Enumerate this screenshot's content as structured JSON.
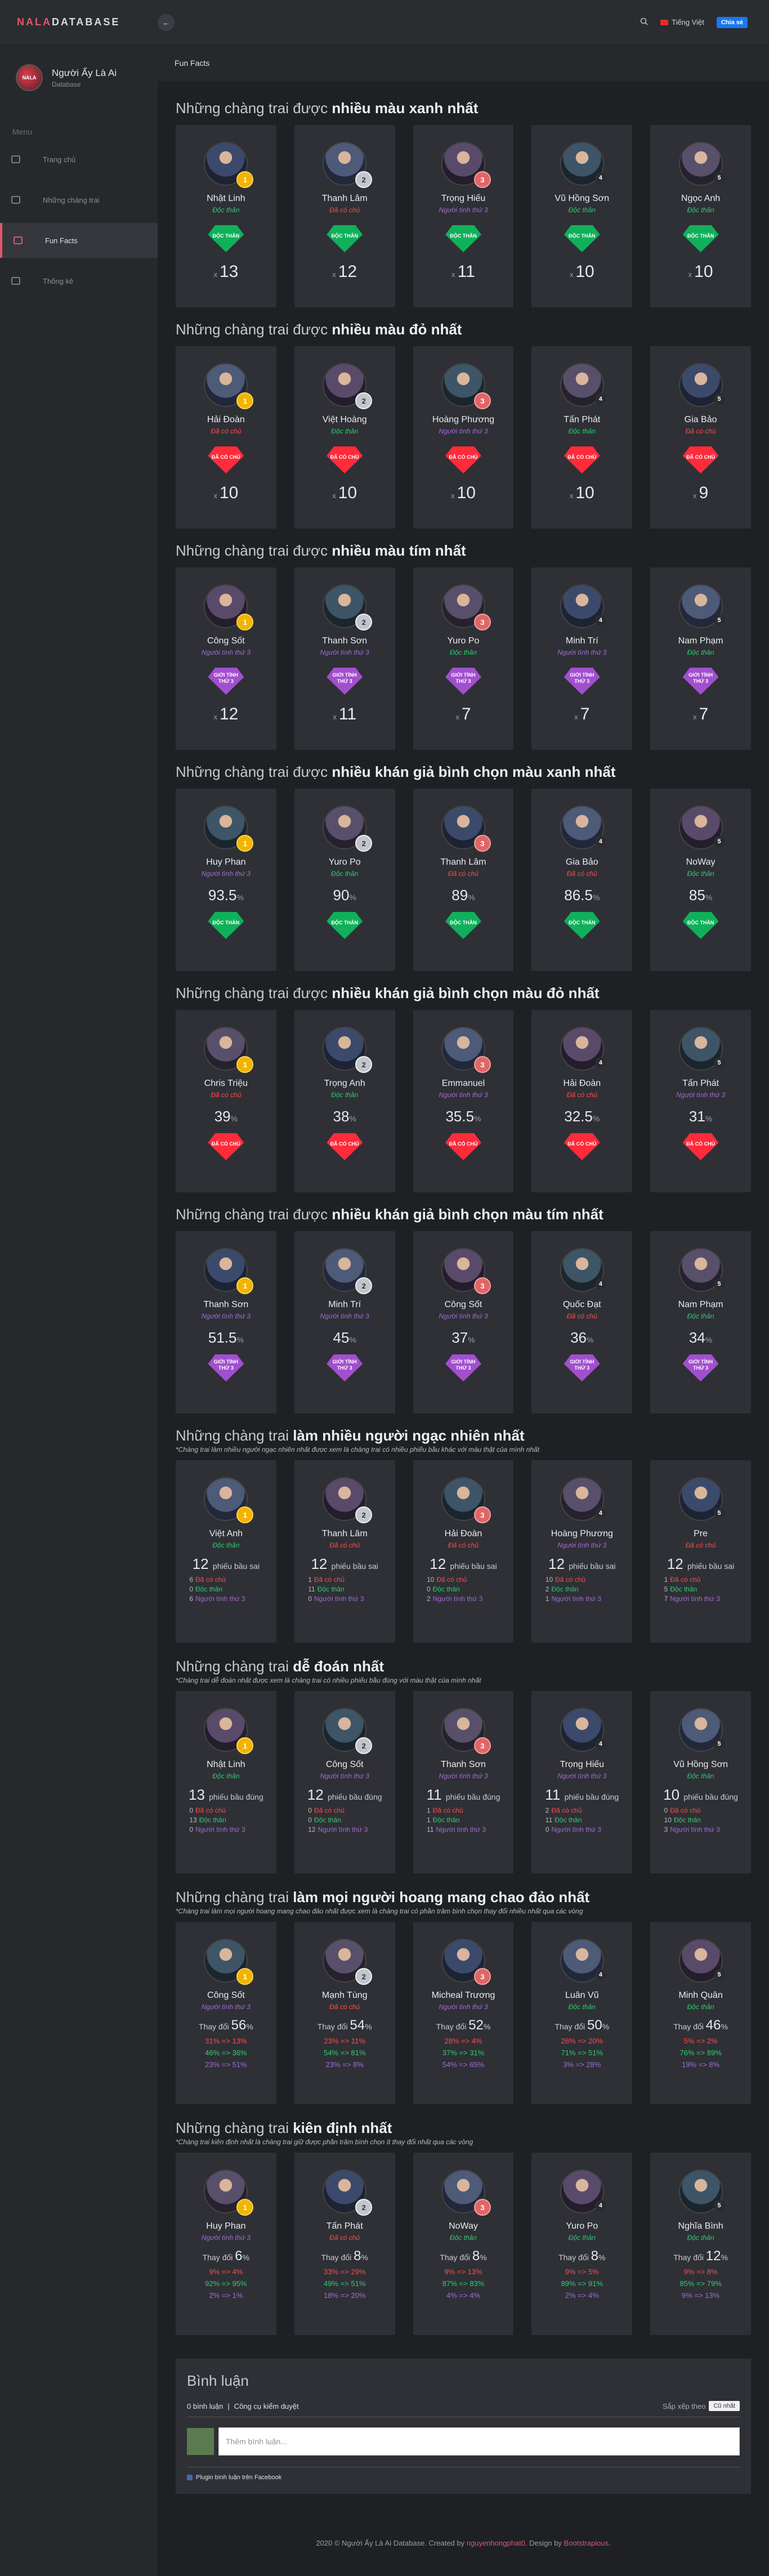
{
  "logo": {
    "part1": "NALA",
    "part2": "DATABASE"
  },
  "topbar": {
    "language": "Tiếng Việt",
    "chat": "Chia sẻ"
  },
  "user": {
    "name": "Người Ấy Là Ai",
    "sub": "Database",
    "avatar_text": "NALA"
  },
  "menu": {
    "label": "Menu",
    "items": [
      {
        "label": "Trang chủ"
      },
      {
        "label": "Những chàng trai"
      },
      {
        "label": "Fun Facts"
      },
      {
        "label": "Thống kê"
      }
    ]
  },
  "breadcrumb": "Fun Facts",
  "sections": [
    {
      "prefix": "Những chàng trai được ",
      "bold": "nhiều màu xanh nhất",
      "kind": "count",
      "note": "",
      "cards": [
        {
          "name": "Nhật Linh",
          "status": "Độc thân",
          "color": "green",
          "gem": "ĐỘC THÂN",
          "value": "13"
        },
        {
          "name": "Thanh Lâm",
          "status": "Đã có chủ",
          "color": "red",
          "gem": "ĐỘC THÂN",
          "value": "12"
        },
        {
          "name": "Trọng Hiếu",
          "status": "Người tình thứ 3",
          "color": "purple",
          "gem": "ĐỘC THÂN",
          "value": "11"
        },
        {
          "name": "Vũ Hồng Sơn",
          "status": "Độc thân",
          "color": "green",
          "gem": "ĐỘC THÂN",
          "value": "10"
        },
        {
          "name": "Ngọc Anh",
          "status": "Độc thân",
          "color": "green",
          "gem": "ĐỘC THÂN",
          "value": "10"
        }
      ]
    },
    {
      "prefix": "Những chàng trai được ",
      "bold": "nhiều màu đỏ nhất",
      "kind": "count",
      "note": "",
      "cards": [
        {
          "name": "Hải Đoàn",
          "status": "Đã có chủ",
          "color": "red",
          "gem": "ĐÃ CÓ CHỦ",
          "value": "10"
        },
        {
          "name": "Việt Hoàng",
          "status": "Độc thân",
          "color": "green",
          "gem": "ĐÃ CÓ CHỦ",
          "value": "10"
        },
        {
          "name": "Hoàng Phương",
          "status": "Người tình thứ 3",
          "color": "purple",
          "gem": "ĐÃ CÓ CHỦ",
          "value": "10"
        },
        {
          "name": "Tấn Phát",
          "status": "Độc thân",
          "color": "green",
          "gem": "ĐÃ CÓ CHỦ",
          "value": "10"
        },
        {
          "name": "Gia Bảo",
          "status": "Đã có chủ",
          "color": "red",
          "gem": "ĐÃ CÓ CHỦ",
          "value": "9"
        }
      ]
    },
    {
      "prefix": "Những chàng trai được ",
      "bold": "nhiều màu tím nhất",
      "kind": "count",
      "note": "",
      "cards": [
        {
          "name": "Công Sốt",
          "status": "Người tình thứ 3",
          "color": "purple",
          "gem": "GIỚI TÍNH THỨ 3",
          "value": "12"
        },
        {
          "name": "Thanh Sơn",
          "status": "Người tình thứ 3",
          "color": "purple",
          "gem": "GIỚI TÍNH THỨ 3",
          "value": "11"
        },
        {
          "name": "Yuro Po",
          "status": "Độc thân",
          "color": "green",
          "gem": "GIỚI TÍNH THỨ 3",
          "value": "7"
        },
        {
          "name": "Minh Trí",
          "status": "Người tình thứ 3",
          "color": "purple",
          "gem": "GIỚI TÍNH THỨ 3",
          "value": "7"
        },
        {
          "name": "Nam Phạm",
          "status": "Độc thân",
          "color": "green",
          "gem": "GIỚI TÍNH THỨ 3",
          "value": "7"
        }
      ]
    },
    {
      "prefix": "Những chàng trai được ",
      "bold": "nhiều khán giả bình chọn màu xanh nhất",
      "kind": "pct",
      "note": "",
      "cards": [
        {
          "name": "Huy Phan",
          "status": "Người tình thứ 3",
          "color": "purple",
          "gem": "ĐỘC THÂN",
          "value": "93.5"
        },
        {
          "name": "Yuro Po",
          "status": "Độc thân",
          "color": "green",
          "gem": "ĐỘC THÂN",
          "value": "90"
        },
        {
          "name": "Thanh Lâm",
          "status": "Đã có chủ",
          "color": "red",
          "gem": "ĐỘC THÂN",
          "value": "89"
        },
        {
          "name": "Gia Bảo",
          "status": "Đã có chủ",
          "color": "red",
          "gem": "ĐỘC THÂN",
          "value": "86.5"
        },
        {
          "name": "NoWay",
          "status": "Độc thân",
          "color": "green",
          "gem": "ĐỘC THÂN",
          "value": "85"
        }
      ]
    },
    {
      "prefix": "Những chàng trai được ",
      "bold": "nhiều khán giả bình chọn màu đỏ nhất",
      "kind": "pct",
      "note": "",
      "cards": [
        {
          "name": "Chris Triệu",
          "status": "Đã có chủ",
          "color": "red",
          "gem": "ĐÃ CÓ CHỦ",
          "value": "39"
        },
        {
          "name": "Trọng Anh",
          "status": "Độc thân",
          "color": "green",
          "gem": "ĐÃ CÓ CHỦ",
          "value": "38"
        },
        {
          "name": "Emmanuel",
          "status": "Người tình thứ 3",
          "color": "purple",
          "gem": "ĐÃ CÓ CHỦ",
          "value": "35.5"
        },
        {
          "name": "Hải Đoàn",
          "status": "Đã có chủ",
          "color": "red",
          "gem": "ĐÃ CÓ CHỦ",
          "value": "32.5"
        },
        {
          "name": "Tấn Phát",
          "status": "Người tình thứ 3",
          "color": "purple",
          "gem": "ĐÃ CÓ CHỦ",
          "value": "31"
        }
      ]
    },
    {
      "prefix": "Những chàng trai được ",
      "bold": "nhiều khán giả bình chọn màu tím nhất",
      "kind": "pct",
      "note": "",
      "cards": [
        {
          "name": "Thanh Sơn",
          "status": "Người tình thứ 3",
          "color": "purple",
          "gem": "GIỚI TÍNH THỨ 3",
          "value": "51.5"
        },
        {
          "name": "Minh Trí",
          "status": "Người tình thứ 3",
          "color": "purple",
          "gem": "GIỚI TÍNH THỨ 3",
          "value": "45"
        },
        {
          "name": "Công Sốt",
          "status": "Người tình thứ 3",
          "color": "purple",
          "gem": "GIỚI TÍNH THỨ 3",
          "value": "37"
        },
        {
          "name": "Quốc Đạt",
          "status": "Đã có chủ",
          "color": "red",
          "gem": "GIỚI TÍNH THỨ 3",
          "value": "36"
        },
        {
          "name": "Nam Phạm",
          "status": "Độc thân",
          "color": "green",
          "gem": "GIỚI TÍNH THỨ 3",
          "value": "34"
        }
      ]
    },
    {
      "prefix": "Những chàng trai ",
      "bold": "làm nhiều người ngạc nhiên nhất",
      "kind": "votes",
      "note": "*Chàng trai làm nhiều người ngạc nhiên nhất được xem là chàng trai có nhiều phiếu bầu khác với màu thật của mình nhất",
      "unit": "phiếu bầu sai",
      "cards": [
        {
          "name": "Việt Anh",
          "status": "Độc thân",
          "color": "green",
          "value": "12",
          "rows": [
            {
              "n": "6",
              "t": "Đã có chủ",
              "c": "red"
            },
            {
              "n": "0",
              "t": "Độc thân",
              "c": "green"
            },
            {
              "n": "6",
              "t": "Người tình thứ 3",
              "c": "purple"
            }
          ]
        },
        {
          "name": "Thanh Lâm",
          "status": "Đã có chủ",
          "color": "red",
          "value": "12",
          "rows": [
            {
              "n": "1",
              "t": "Đã có chủ",
              "c": "red"
            },
            {
              "n": "11",
              "t": "Độc thân",
              "c": "green"
            },
            {
              "n": "0",
              "t": "Người tình thứ 3",
              "c": "purple"
            }
          ]
        },
        {
          "name": "Hải Đoàn",
          "status": "Đã có chủ",
          "color": "red",
          "value": "12",
          "rows": [
            {
              "n": "10",
              "t": "Đã có chủ",
              "c": "red"
            },
            {
              "n": "0",
              "t": "Độc thân",
              "c": "green"
            },
            {
              "n": "2",
              "t": "Người tình thứ 3",
              "c": "purple"
            }
          ]
        },
        {
          "name": "Hoàng Phương",
          "status": "Người tình thứ 3",
          "color": "purple",
          "value": "12",
          "rows": [
            {
              "n": "10",
              "t": "Đã có chủ",
              "c": "red"
            },
            {
              "n": "2",
              "t": "Độc thân",
              "c": "green"
            },
            {
              "n": "1",
              "t": "Người tình thứ 3",
              "c": "purple"
            }
          ]
        },
        {
          "name": "Pre",
          "status": "Đã có chủ",
          "color": "red",
          "value": "12",
          "rows": [
            {
              "n": "1",
              "t": "Đã có chủ",
              "c": "red"
            },
            {
              "n": "5",
              "t": "Độc thân",
              "c": "green"
            },
            {
              "n": "7",
              "t": "Người tình thứ 3",
              "c": "purple"
            }
          ]
        }
      ]
    },
    {
      "prefix": "Những chàng trai ",
      "bold": "dễ đoán nhất",
      "kind": "votes",
      "note": "*Chàng trai dễ đoán nhất được xem là chàng trai có nhiều phiếu bầu đúng với màu thật của mình nhất",
      "unit": "phiếu bầu đúng",
      "cards": [
        {
          "name": "Nhật Linh",
          "status": "Độc thân",
          "color": "green",
          "value": "13",
          "rows": [
            {
              "n": "0",
              "t": "Đã có chủ",
              "c": "red"
            },
            {
              "n": "13",
              "t": "Độc thân",
              "c": "green"
            },
            {
              "n": "0",
              "t": "Người tình thứ 3",
              "c": "purple"
            }
          ]
        },
        {
          "name": "Công Sốt",
          "status": "Người tình thứ 3",
          "color": "purple",
          "value": "12",
          "rows": [
            {
              "n": "0",
              "t": "Đã có chủ",
              "c": "red"
            },
            {
              "n": "0",
              "t": "Độc thân",
              "c": "green"
            },
            {
              "n": "12",
              "t": "Người tình thứ 3",
              "c": "purple"
            }
          ]
        },
        {
          "name": "Thanh Sơn",
          "status": "Người tình thứ 3",
          "color": "purple",
          "value": "11",
          "rows": [
            {
              "n": "1",
              "t": "Đã có chủ",
              "c": "red"
            },
            {
              "n": "1",
              "t": "Độc thân",
              "c": "green"
            },
            {
              "n": "11",
              "t": "Người tình thứ 3",
              "c": "purple"
            }
          ]
        },
        {
          "name": "Trọng Hiếu",
          "status": "Người tình thứ 3",
          "color": "purple",
          "value": "11",
          "rows": [
            {
              "n": "2",
              "t": "Đã có chủ",
              "c": "red"
            },
            {
              "n": "11",
              "t": "Độc thân",
              "c": "green"
            },
            {
              "n": "0",
              "t": "Người tình thứ 3",
              "c": "purple"
            }
          ]
        },
        {
          "name": "Vũ Hồng Sơn",
          "status": "Độc thân",
          "color": "green",
          "value": "10",
          "rows": [
            {
              "n": "0",
              "t": "Đã có chủ",
              "c": "red"
            },
            {
              "n": "10",
              "t": "Độc thân",
              "c": "green"
            },
            {
              "n": "3",
              "t": "Người tình thứ 3",
              "c": "purple"
            }
          ]
        }
      ]
    },
    {
      "prefix": "Những chàng trai ",
      "bold": "làm mọi người hoang mang chao đảo nhất",
      "kind": "delta",
      "note": "*Chàng trai làm mọi người hoang mang chao đảo nhất được xem là chàng trai có phần trăm bình chọn thay đổi nhiều nhất qua các vòng",
      "dlabel": "Thay đổi",
      "cards": [
        {
          "name": "Công Sốt",
          "status": "Người tình thứ 3",
          "color": "purple",
          "value": "56",
          "rows": [
            {
              "t": "31% => 13%",
              "c": "red"
            },
            {
              "t": "46% => 36%",
              "c": "green"
            },
            {
              "t": "23% => 51%",
              "c": "purple"
            }
          ]
        },
        {
          "name": "Mạnh Tùng",
          "status": "Đã có chủ",
          "color": "red",
          "value": "54",
          "rows": [
            {
              "t": "23% => 11%",
              "c": "red"
            },
            {
              "t": "54% => 81%",
              "c": "green"
            },
            {
              "t": "23% => 8%",
              "c": "purple"
            }
          ]
        },
        {
          "name": "Micheal Trương",
          "status": "Người tình thứ 3",
          "color": "purple",
          "value": "52",
          "rows": [
            {
              "t": "28% => 4%",
              "c": "red"
            },
            {
              "t": "37% => 31%",
              "c": "green"
            },
            {
              "t": "54% => 65%",
              "c": "purple"
            }
          ]
        },
        {
          "name": "Luân Vũ",
          "status": "Độc thân",
          "color": "green",
          "value": "50",
          "rows": [
            {
              "t": "26% => 20%",
              "c": "red"
            },
            {
              "t": "71% => 51%",
              "c": "green"
            },
            {
              "t": "3% => 28%",
              "c": "purple"
            }
          ]
        },
        {
          "name": "Minh Quân",
          "status": "Độc thân",
          "color": "green",
          "value": "46",
          "rows": [
            {
              "t": "5% => 2%",
              "c": "red"
            },
            {
              "t": "76% => 89%",
              "c": "green"
            },
            {
              "t": "19% => 8%",
              "c": "purple"
            }
          ]
        }
      ]
    },
    {
      "prefix": "Những chàng trai ",
      "bold": "kiên định nhất",
      "kind": "delta",
      "note": "*Chàng trai kiên định nhất là chàng trai giữ được phần trăm bình chọn ít thay đổi nhất qua các vòng",
      "dlabel": "Thay đổi",
      "cards": [
        {
          "name": "Huy Phan",
          "status": "Người tình thứ 3",
          "color": "purple",
          "value": "6",
          "rows": [
            {
              "t": "9% => 4%",
              "c": "red"
            },
            {
              "t": "92% => 95%",
              "c": "green"
            },
            {
              "t": "2% => 1%",
              "c": "purple"
            }
          ]
        },
        {
          "name": "Tấn Phát",
          "status": "Đã có chủ",
          "color": "red",
          "value": "8",
          "rows": [
            {
              "t": "33% => 29%",
              "c": "red"
            },
            {
              "t": "49% => 51%",
              "c": "green"
            },
            {
              "t": "18% => 20%",
              "c": "purple"
            }
          ]
        },
        {
          "name": "NoWay",
          "status": "Độc thân",
          "color": "green",
          "value": "8",
          "rows": [
            {
              "t": "9% => 13%",
              "c": "red"
            },
            {
              "t": "87% => 83%",
              "c": "green"
            },
            {
              "t": "4% => 4%",
              "c": "purple"
            }
          ]
        },
        {
          "name": "Yuro Po",
          "status": "Độc thân",
          "color": "green",
          "value": "8",
          "rows": [
            {
              "t": "9% => 5%",
              "c": "red"
            },
            {
              "t": "89% => 91%",
              "c": "green"
            },
            {
              "t": "2% => 4%",
              "c": "purple"
            }
          ]
        },
        {
          "name": "Nghĩa Bình",
          "status": "Độc thân",
          "color": "green",
          "value": "12",
          "rows": [
            {
              "t": "9% => 8%",
              "c": "red"
            },
            {
              "t": "85% => 79%",
              "c": "green"
            },
            {
              "t": "9% => 13%",
              "c": "purple"
            }
          ]
        }
      ]
    }
  ],
  "comments": {
    "title": "Bình luận",
    "count": "0 bình luận",
    "tools": "Công cụ kiểm duyệt",
    "sort_label": "Sắp xếp theo",
    "sort_value": "Cũ nhất",
    "placeholder": "Thêm bình luận...",
    "plugin": "Plugin bình luận trên Facebook"
  },
  "footer": {
    "pre": "2020 © Người Ấy Là Ai Database. Created by ",
    "creator": "nguyenhongphat0",
    "mid": ". Design by ",
    "designer": "Bootstrapious",
    "end": "."
  }
}
